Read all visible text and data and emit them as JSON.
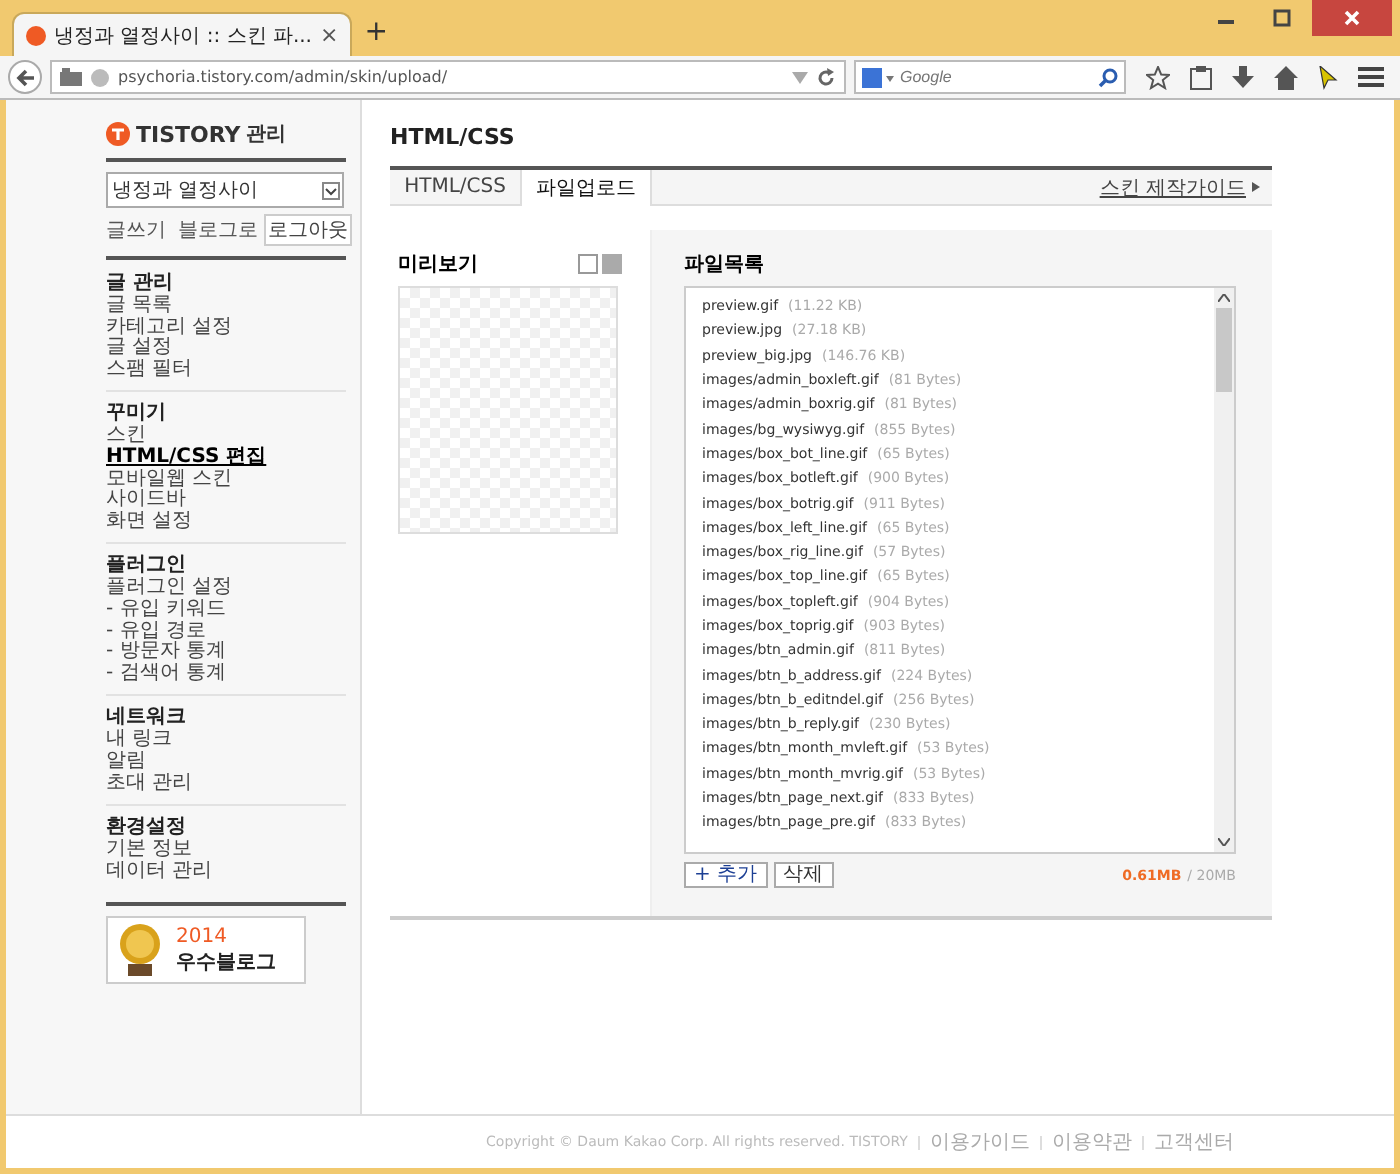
{
  "browser": {
    "tab": {
      "title": "냉정과 열정사이 :: 스킨 파...",
      "close": "×"
    },
    "new_tab": "+",
    "url": "psychoria.tistory.com/admin/skin/upload/",
    "search": {
      "placeholder": "Google"
    }
  },
  "sidebar": {
    "logo": "TISTORY",
    "logo_suffix": "관리",
    "blog_select": "냉정과 열정사이",
    "links": [
      "글쓰기",
      "블로그로"
    ],
    "logout": "로그아웃",
    "groups": [
      {
        "title": "글 관리",
        "items": [
          {
            "label": "글 목록",
            "selected": false
          },
          {
            "label": "카테고리 설정",
            "selected": false
          },
          {
            "label": "글 설정",
            "selected": false
          },
          {
            "label": "스팸 필터",
            "selected": false
          }
        ]
      },
      {
        "title": "꾸미기",
        "items": [
          {
            "label": "스킨",
            "selected": false
          },
          {
            "label": "HTML/CSS 편집",
            "selected": true
          },
          {
            "label": "모바일웹 스킨",
            "selected": false
          },
          {
            "label": "사이드바",
            "selected": false
          },
          {
            "label": "화면 설정",
            "selected": false
          }
        ]
      },
      {
        "title": "플러그인",
        "items": [
          {
            "label": "플러그인 설정",
            "selected": false
          },
          {
            "label": "- 유입 키워드",
            "selected": false
          },
          {
            "label": "- 유입 경로",
            "selected": false
          },
          {
            "label": "- 방문자 통계",
            "selected": false
          },
          {
            "label": "- 검색어 통계",
            "selected": false
          }
        ]
      },
      {
        "title": "네트워크",
        "items": [
          {
            "label": "내 링크",
            "selected": false
          },
          {
            "label": "알림",
            "selected": false
          },
          {
            "label": "초대 관리",
            "selected": false
          }
        ]
      },
      {
        "title": "환경설정",
        "items": [
          {
            "label": "기본 정보",
            "selected": false
          },
          {
            "label": "데이터 관리",
            "selected": false
          }
        ]
      }
    ],
    "badge": {
      "year": "2014",
      "label": "우수블로그"
    }
  },
  "main": {
    "title": "HTML/CSS",
    "tabs": [
      {
        "label": "HTML/CSS",
        "selected": false
      },
      {
        "label": "파일업로드",
        "selected": true
      }
    ],
    "guide_link": "스킨 제작가이드",
    "preview": {
      "label": "미리보기"
    },
    "files": {
      "label": "파일목록",
      "items": [
        {
          "name": "preview.gif",
          "size": "(11.22 KB)"
        },
        {
          "name": "preview.jpg",
          "size": "(27.18 KB)"
        },
        {
          "name": "preview_big.jpg",
          "size": "(146.76 KB)"
        },
        {
          "name": "images/admin_boxleft.gif",
          "size": "(81 Bytes)"
        },
        {
          "name": "images/admin_boxrig.gif",
          "size": "(81 Bytes)"
        },
        {
          "name": "images/bg_wysiwyg.gif",
          "size": "(855 Bytes)"
        },
        {
          "name": "images/box_bot_line.gif",
          "size": "(65 Bytes)"
        },
        {
          "name": "images/box_botleft.gif",
          "size": "(900 Bytes)"
        },
        {
          "name": "images/box_botrig.gif",
          "size": "(911 Bytes)"
        },
        {
          "name": "images/box_left_line.gif",
          "size": "(65 Bytes)"
        },
        {
          "name": "images/box_rig_line.gif",
          "size": "(57 Bytes)"
        },
        {
          "name": "images/box_top_line.gif",
          "size": "(65 Bytes)"
        },
        {
          "name": "images/box_topleft.gif",
          "size": "(904 Bytes)"
        },
        {
          "name": "images/box_toprig.gif",
          "size": "(903 Bytes)"
        },
        {
          "name": "images/btn_admin.gif",
          "size": "(811 Bytes)"
        },
        {
          "name": "images/btn_b_address.gif",
          "size": "(224 Bytes)"
        },
        {
          "name": "images/btn_b_editndel.gif",
          "size": "(256 Bytes)"
        },
        {
          "name": "images/btn_b_reply.gif",
          "size": "(230 Bytes)"
        },
        {
          "name": "images/btn_month_mvleft.gif",
          "size": "(53 Bytes)"
        },
        {
          "name": "images/btn_month_mvrig.gif",
          "size": "(53 Bytes)"
        },
        {
          "name": "images/btn_page_next.gif",
          "size": "(833 Bytes)"
        },
        {
          "name": "images/btn_page_pre.gif",
          "size": "(833 Bytes)"
        }
      ],
      "add_button": "+ 추가",
      "delete_button": "삭제",
      "used": "0.61MB",
      "quota": "/ 20MB"
    }
  },
  "footer": {
    "copyright": "Copyright © Daum Kakao Corp. All rights reserved. TISTORY",
    "links": [
      "이용가이드",
      "이용약관",
      "고객센터"
    ]
  }
}
